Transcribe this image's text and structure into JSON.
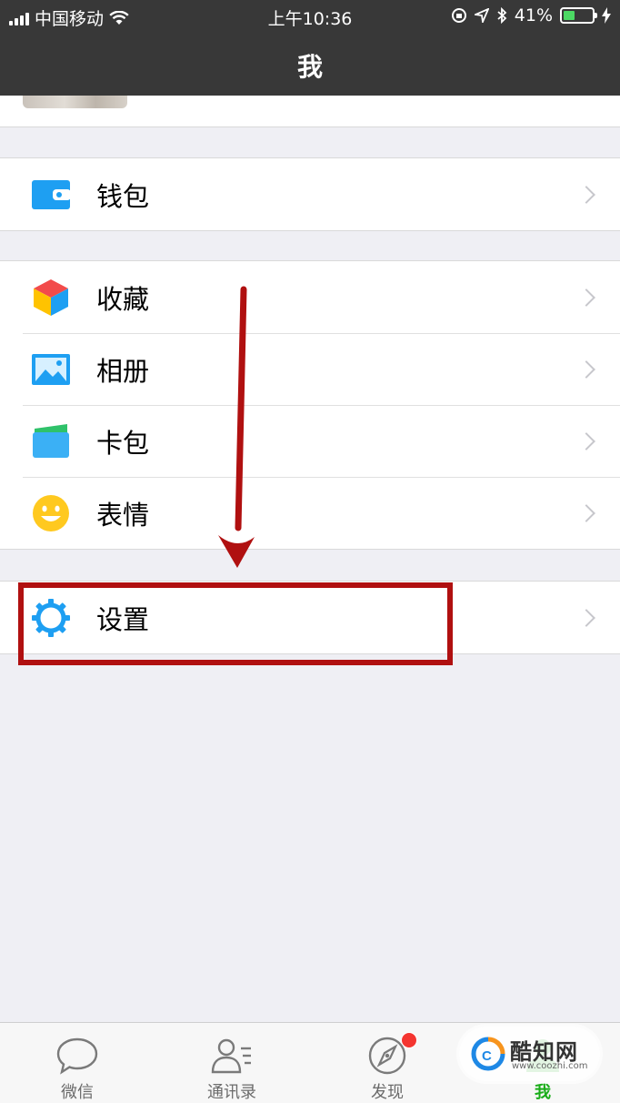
{
  "status_bar": {
    "carrier": "中国移动",
    "time": "上午10:36",
    "battery_percent": "41%",
    "battery_level": 0.41
  },
  "nav": {
    "title": "我"
  },
  "groups": {
    "wallet": {
      "label": "钱包"
    },
    "favorites": {
      "label": "收藏"
    },
    "album": {
      "label": "相册"
    },
    "cards": {
      "label": "卡包"
    },
    "stickers": {
      "label": "表情"
    },
    "settings": {
      "label": "设置"
    }
  },
  "tabbar": {
    "tabs": [
      {
        "label": "微信",
        "icon": "chat-bubble-icon",
        "active": false
      },
      {
        "label": "通讯录",
        "icon": "contacts-icon",
        "active": false
      },
      {
        "label": "发现",
        "icon": "compass-icon",
        "active": false,
        "badge": true
      },
      {
        "label": "我",
        "icon": "me-icon",
        "active": true
      }
    ]
  },
  "watermark": {
    "brand": "酷知网",
    "url": "www.coozhi.com"
  },
  "colors": {
    "topbar": "#383838",
    "active_tab": "#1aad19",
    "annotation": "#b01010",
    "background": "#efeff4"
  }
}
